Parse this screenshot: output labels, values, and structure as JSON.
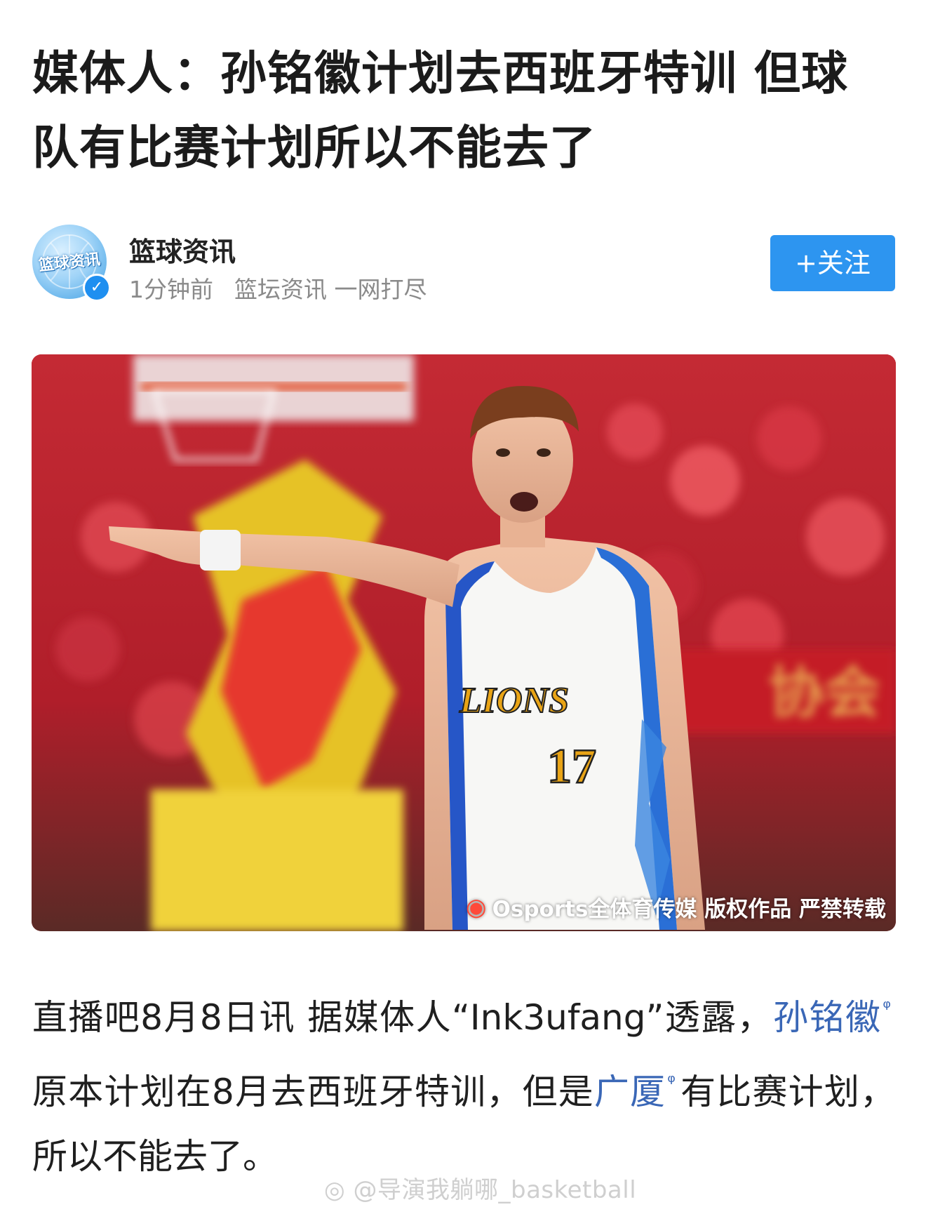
{
  "article": {
    "title": "媒体人：孙铭徽计划去西班牙特训 但球队有比赛计划所以不能去了"
  },
  "author": {
    "avatar_text": "篮球资讯",
    "verified_icon": "verified-check-icon",
    "name": "篮球资讯",
    "time": "1分钟前",
    "bio": "篮坛资讯 一网打尽",
    "follow_label": "+关注"
  },
  "photo": {
    "jersey_text": "LIONS",
    "jersey_number": "17",
    "watermark": "Osports全体育传媒 版权作品 严禁转载",
    "banner_text": "协会"
  },
  "body": {
    "part1": "直播吧8月8日讯  据媒体人“Ink3ufang”透露，",
    "link1": "孙铭徽",
    "part2": "原本计划在8月去西班牙特训，但是",
    "link2": "广厦",
    "part3": "有比赛计划，所以不能去了。",
    "search_mark": "ᵠ"
  },
  "footer": {
    "watermark": "@导演我躺哪_basketball"
  },
  "colors": {
    "accent": "#2d95f0",
    "link": "#3a67b6"
  }
}
